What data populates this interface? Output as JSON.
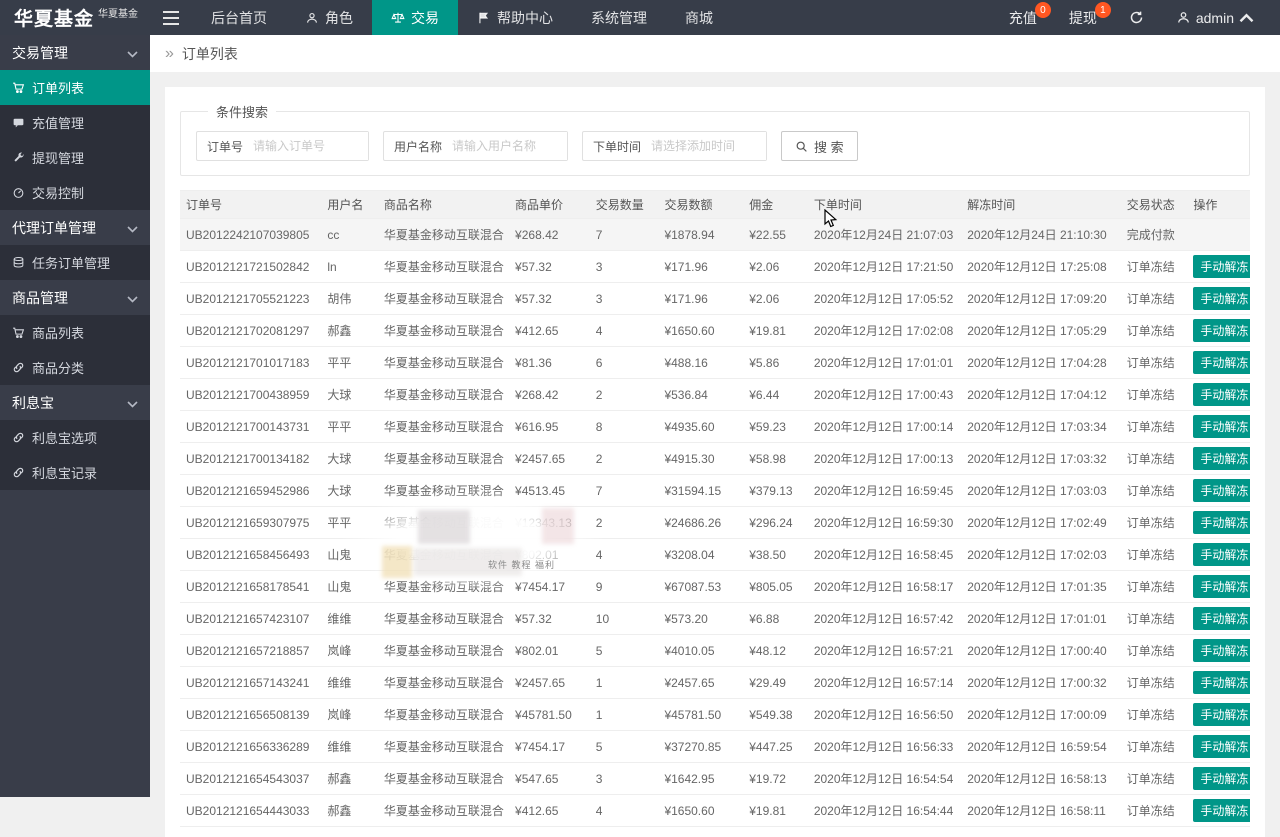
{
  "colors": {
    "accent": "#009688",
    "header_bg": "#373d49",
    "sidebar_bg": "#393D49",
    "badge": "#FF5722"
  },
  "header": {
    "logo_main": "华夏基金",
    "logo_sup": "华夏基金",
    "nav": [
      {
        "label": "后台首页",
        "icon": "",
        "active": false
      },
      {
        "label": "角色",
        "icon": "person-icon",
        "active": false
      },
      {
        "label": "交易",
        "icon": "scales-icon",
        "active": true
      },
      {
        "label": "帮助中心",
        "icon": "flag-icon",
        "active": false
      },
      {
        "label": "系统管理",
        "icon": "",
        "active": false
      },
      {
        "label": "商城",
        "icon": "",
        "active": false
      }
    ],
    "recharge_label": "充值",
    "recharge_badge": "0",
    "withdraw_label": "提现",
    "withdraw_badge": "1",
    "username": "admin"
  },
  "sidebar": {
    "groups": [
      {
        "label": "交易管理",
        "items": [
          {
            "label": "订单列表",
            "icon": "cart-icon",
            "active": true
          },
          {
            "label": "充值管理",
            "icon": "card-icon",
            "active": false
          },
          {
            "label": "提现管理",
            "icon": "wrench-icon",
            "active": false
          },
          {
            "label": "交易控制",
            "icon": "gauge-icon",
            "active": false
          }
        ]
      },
      {
        "label": "代理订单管理",
        "items": [
          {
            "label": "任务订单管理",
            "icon": "coins-icon",
            "active": false
          }
        ]
      },
      {
        "label": "商品管理",
        "items": [
          {
            "label": "商品列表",
            "icon": "cart-icon",
            "active": false
          },
          {
            "label": "商品分类",
            "icon": "link-icon",
            "active": false
          }
        ]
      },
      {
        "label": "利息宝",
        "items": [
          {
            "label": "利息宝选项",
            "icon": "link-icon",
            "active": false
          },
          {
            "label": "利息宝记录",
            "icon": "link-icon",
            "active": false
          }
        ]
      }
    ]
  },
  "breadcrumb": {
    "arrow": "»",
    "title": "订单列表"
  },
  "search": {
    "legend": "条件搜索",
    "fields": [
      {
        "label": "订单号",
        "placeholder": "请输入订单号"
      },
      {
        "label": "用户名称",
        "placeholder": "请输入用户名称"
      },
      {
        "label": "下单时间",
        "placeholder": "请选择添加时间"
      }
    ],
    "button_label": "搜 索"
  },
  "table": {
    "columns": [
      "订单号",
      "用户名",
      "商品名称",
      "商品单价",
      "交易数量",
      "交易数额",
      "佣金",
      "下单时间",
      "解冻时间",
      "交易状态",
      "操作"
    ],
    "unfreeze_label": "手动解冻",
    "rows": [
      {
        "order": "UB2012242107039805",
        "user": "cc",
        "product": "华夏基金移动互联混合",
        "price": "¥268.42",
        "qty": "7",
        "amount": "¥1878.94",
        "commission": "¥22.55",
        "time": "2020年12月24日 21:07:03",
        "unfreeze": "2020年12月24日 21:10:30",
        "status": "完成付款",
        "action": false
      },
      {
        "order": "UB2012121721502842",
        "user": "ln",
        "product": "华夏基金移动互联混合",
        "price": "¥57.32",
        "qty": "3",
        "amount": "¥171.96",
        "commission": "¥2.06",
        "time": "2020年12月12日 17:21:50",
        "unfreeze": "2020年12月12日 17:25:08",
        "status": "订单冻结",
        "action": true
      },
      {
        "order": "UB2012121705521223",
        "user": "胡伟",
        "product": "华夏基金移动互联混合",
        "price": "¥57.32",
        "qty": "3",
        "amount": "¥171.96",
        "commission": "¥2.06",
        "time": "2020年12月12日 17:05:52",
        "unfreeze": "2020年12月12日 17:09:20",
        "status": "订单冻结",
        "action": true
      },
      {
        "order": "UB2012121702081297",
        "user": "郝鑫",
        "product": "华夏基金移动互联混合",
        "price": "¥412.65",
        "qty": "4",
        "amount": "¥1650.60",
        "commission": "¥19.81",
        "time": "2020年12月12日 17:02:08",
        "unfreeze": "2020年12月12日 17:05:29",
        "status": "订单冻结",
        "action": true
      },
      {
        "order": "UB2012121701017183",
        "user": "平平",
        "product": "华夏基金移动互联混合",
        "price": "¥81.36",
        "qty": "6",
        "amount": "¥488.16",
        "commission": "¥5.86",
        "time": "2020年12月12日 17:01:01",
        "unfreeze": "2020年12月12日 17:04:28",
        "status": "订单冻结",
        "action": true
      },
      {
        "order": "UB2012121700438959",
        "user": "大球",
        "product": "华夏基金移动互联混合",
        "price": "¥268.42",
        "qty": "2",
        "amount": "¥536.84",
        "commission": "¥6.44",
        "time": "2020年12月12日 17:00:43",
        "unfreeze": "2020年12月12日 17:04:12",
        "status": "订单冻结",
        "action": true
      },
      {
        "order": "UB2012121700143731",
        "user": "平平",
        "product": "华夏基金移动互联混合",
        "price": "¥616.95",
        "qty": "8",
        "amount": "¥4935.60",
        "commission": "¥59.23",
        "time": "2020年12月12日 17:00:14",
        "unfreeze": "2020年12月12日 17:03:34",
        "status": "订单冻结",
        "action": true
      },
      {
        "order": "UB2012121700134182",
        "user": "大球",
        "product": "华夏基金移动互联混合",
        "price": "¥2457.65",
        "qty": "2",
        "amount": "¥4915.30",
        "commission": "¥58.98",
        "time": "2020年12月12日 17:00:13",
        "unfreeze": "2020年12月12日 17:03:32",
        "status": "订单冻结",
        "action": true
      },
      {
        "order": "UB2012121659452986",
        "user": "大球",
        "product": "华夏基金移动互联混合",
        "price": "¥4513.45",
        "qty": "7",
        "amount": "¥31594.15",
        "commission": "¥379.13",
        "time": "2020年12月12日 16:59:45",
        "unfreeze": "2020年12月12日 17:03:03",
        "status": "订单冻结",
        "action": true
      },
      {
        "order": "UB2012121659307975",
        "user": "平平",
        "product": "华夏基金移动互联混合",
        "price": "¥12343.13",
        "qty": "2",
        "amount": "¥24686.26",
        "commission": "¥296.24",
        "time": "2020年12月12日 16:59:30",
        "unfreeze": "2020年12月12日 17:02:49",
        "status": "订单冻结",
        "action": true
      },
      {
        "order": "UB2012121658456493",
        "user": "山鬼",
        "product": "华夏基金移动互联混合",
        "price": "¥802.01",
        "qty": "4",
        "amount": "¥3208.04",
        "commission": "¥38.50",
        "time": "2020年12月12日 16:58:45",
        "unfreeze": "2020年12月12日 17:02:03",
        "status": "订单冻结",
        "action": true
      },
      {
        "order": "UB2012121658178541",
        "user": "山鬼",
        "product": "华夏基金移动互联混合",
        "price": "¥7454.17",
        "qty": "9",
        "amount": "¥67087.53",
        "commission": "¥805.05",
        "time": "2020年12月12日 16:58:17",
        "unfreeze": "2020年12月12日 17:01:35",
        "status": "订单冻结",
        "action": true
      },
      {
        "order": "UB2012121657423107",
        "user": "维维",
        "product": "华夏基金移动互联混合",
        "price": "¥57.32",
        "qty": "10",
        "amount": "¥573.20",
        "commission": "¥6.88",
        "time": "2020年12月12日 16:57:42",
        "unfreeze": "2020年12月12日 17:01:01",
        "status": "订单冻结",
        "action": true
      },
      {
        "order": "UB2012121657218857",
        "user": "岚峰",
        "product": "华夏基金移动互联混合",
        "price": "¥802.01",
        "qty": "5",
        "amount": "¥4010.05",
        "commission": "¥48.12",
        "time": "2020年12月12日 16:57:21",
        "unfreeze": "2020年12月12日 17:00:40",
        "status": "订单冻结",
        "action": true
      },
      {
        "order": "UB2012121657143241",
        "user": "维维",
        "product": "华夏基金移动互联混合",
        "price": "¥2457.65",
        "qty": "1",
        "amount": "¥2457.65",
        "commission": "¥29.49",
        "time": "2020年12月12日 16:57:14",
        "unfreeze": "2020年12月12日 17:00:32",
        "status": "订单冻结",
        "action": true
      },
      {
        "order": "UB2012121656508139",
        "user": "岚峰",
        "product": "华夏基金移动互联混合",
        "price": "¥45781.50",
        "qty": "1",
        "amount": "¥45781.50",
        "commission": "¥549.38",
        "time": "2020年12月12日 16:56:50",
        "unfreeze": "2020年12月12日 17:00:09",
        "status": "订单冻结",
        "action": true
      },
      {
        "order": "UB2012121656336289",
        "user": "维维",
        "product": "华夏基金移动互联混合",
        "price": "¥7454.17",
        "qty": "5",
        "amount": "¥37270.85",
        "commission": "¥447.25",
        "time": "2020年12月12日 16:56:33",
        "unfreeze": "2020年12月12日 16:59:54",
        "status": "订单冻结",
        "action": true
      },
      {
        "order": "UB2012121654543037",
        "user": "郝鑫",
        "product": "华夏基金移动互联混合",
        "price": "¥547.65",
        "qty": "3",
        "amount": "¥1642.95",
        "commission": "¥19.72",
        "time": "2020年12月12日 16:54:54",
        "unfreeze": "2020年12月12日 16:58:13",
        "status": "订单冻结",
        "action": true
      },
      {
        "order": "UB2012121654443033",
        "user": "郝鑫",
        "product": "华夏基金移动互联混合",
        "price": "¥412.65",
        "qty": "4",
        "amount": "¥1650.60",
        "commission": "¥19.81",
        "time": "2020年12月12日 16:54:44",
        "unfreeze": "2020年12月12日 16:58:11",
        "status": "订单冻结",
        "action": true
      }
    ]
  },
  "watermark": {
    "text": "软件 教程 福利"
  }
}
